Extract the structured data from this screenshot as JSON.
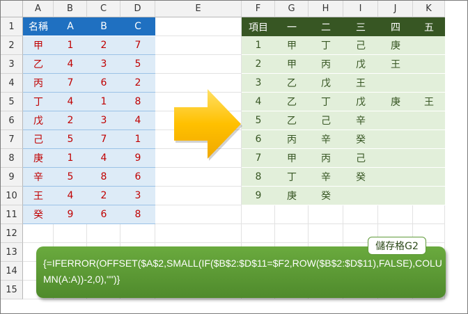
{
  "columns": [
    "A",
    "B",
    "C",
    "D",
    "E",
    "F",
    "G",
    "H",
    "I",
    "J",
    "K"
  ],
  "rows": [
    "1",
    "2",
    "3",
    "4",
    "5",
    "6",
    "7",
    "8",
    "9",
    "10",
    "11",
    "12",
    "13",
    "14",
    "15"
  ],
  "left_table": {
    "headers": [
      "名稱",
      "A",
      "B",
      "C"
    ],
    "rows": [
      [
        "甲",
        "1",
        "2",
        "7"
      ],
      [
        "乙",
        "4",
        "3",
        "5"
      ],
      [
        "丙",
        "7",
        "6",
        "2"
      ],
      [
        "丁",
        "4",
        "1",
        "8"
      ],
      [
        "戊",
        "2",
        "3",
        "4"
      ],
      [
        "己",
        "5",
        "7",
        "1"
      ],
      [
        "庚",
        "1",
        "4",
        "9"
      ],
      [
        "辛",
        "5",
        "8",
        "6"
      ],
      [
        "王",
        "4",
        "2",
        "3"
      ],
      [
        "癸",
        "9",
        "6",
        "8"
      ]
    ]
  },
  "right_table": {
    "headers": [
      "項目",
      "一",
      "二",
      "三",
      "四",
      "五"
    ],
    "rows": [
      [
        "1",
        "甲",
        "丁",
        "己",
        "庚",
        ""
      ],
      [
        "2",
        "甲",
        "丙",
        "戊",
        "王",
        ""
      ],
      [
        "3",
        "乙",
        "戊",
        "王",
        "",
        ""
      ],
      [
        "4",
        "乙",
        "丁",
        "戊",
        "庚",
        "王"
      ],
      [
        "5",
        "乙",
        "己",
        "辛",
        "",
        ""
      ],
      [
        "6",
        "丙",
        "辛",
        "癸",
        "",
        ""
      ],
      [
        "7",
        "甲",
        "丙",
        "己",
        "",
        ""
      ],
      [
        "8",
        "丁",
        "辛",
        "癸",
        "",
        ""
      ],
      [
        "9",
        "庚",
        "癸",
        "",
        "",
        ""
      ]
    ]
  },
  "callout": {
    "label": "儲存格G2",
    "formula": "{=IFERROR(OFFSET($A$2,SMALL(IF($B$2:$D$11=$F2,ROW($B$2:$D$11),FALSE),COLUMN(A:A))-2,0),\"\")}"
  },
  "icons": {
    "arrow": "right-arrow-icon"
  },
  "colors": {
    "left_header": "#1f70c1",
    "left_body": "#ddebf7",
    "left_text": "#c00000",
    "right_header": "#375623",
    "right_body": "#e2efda",
    "callout": "#5a9a34"
  }
}
